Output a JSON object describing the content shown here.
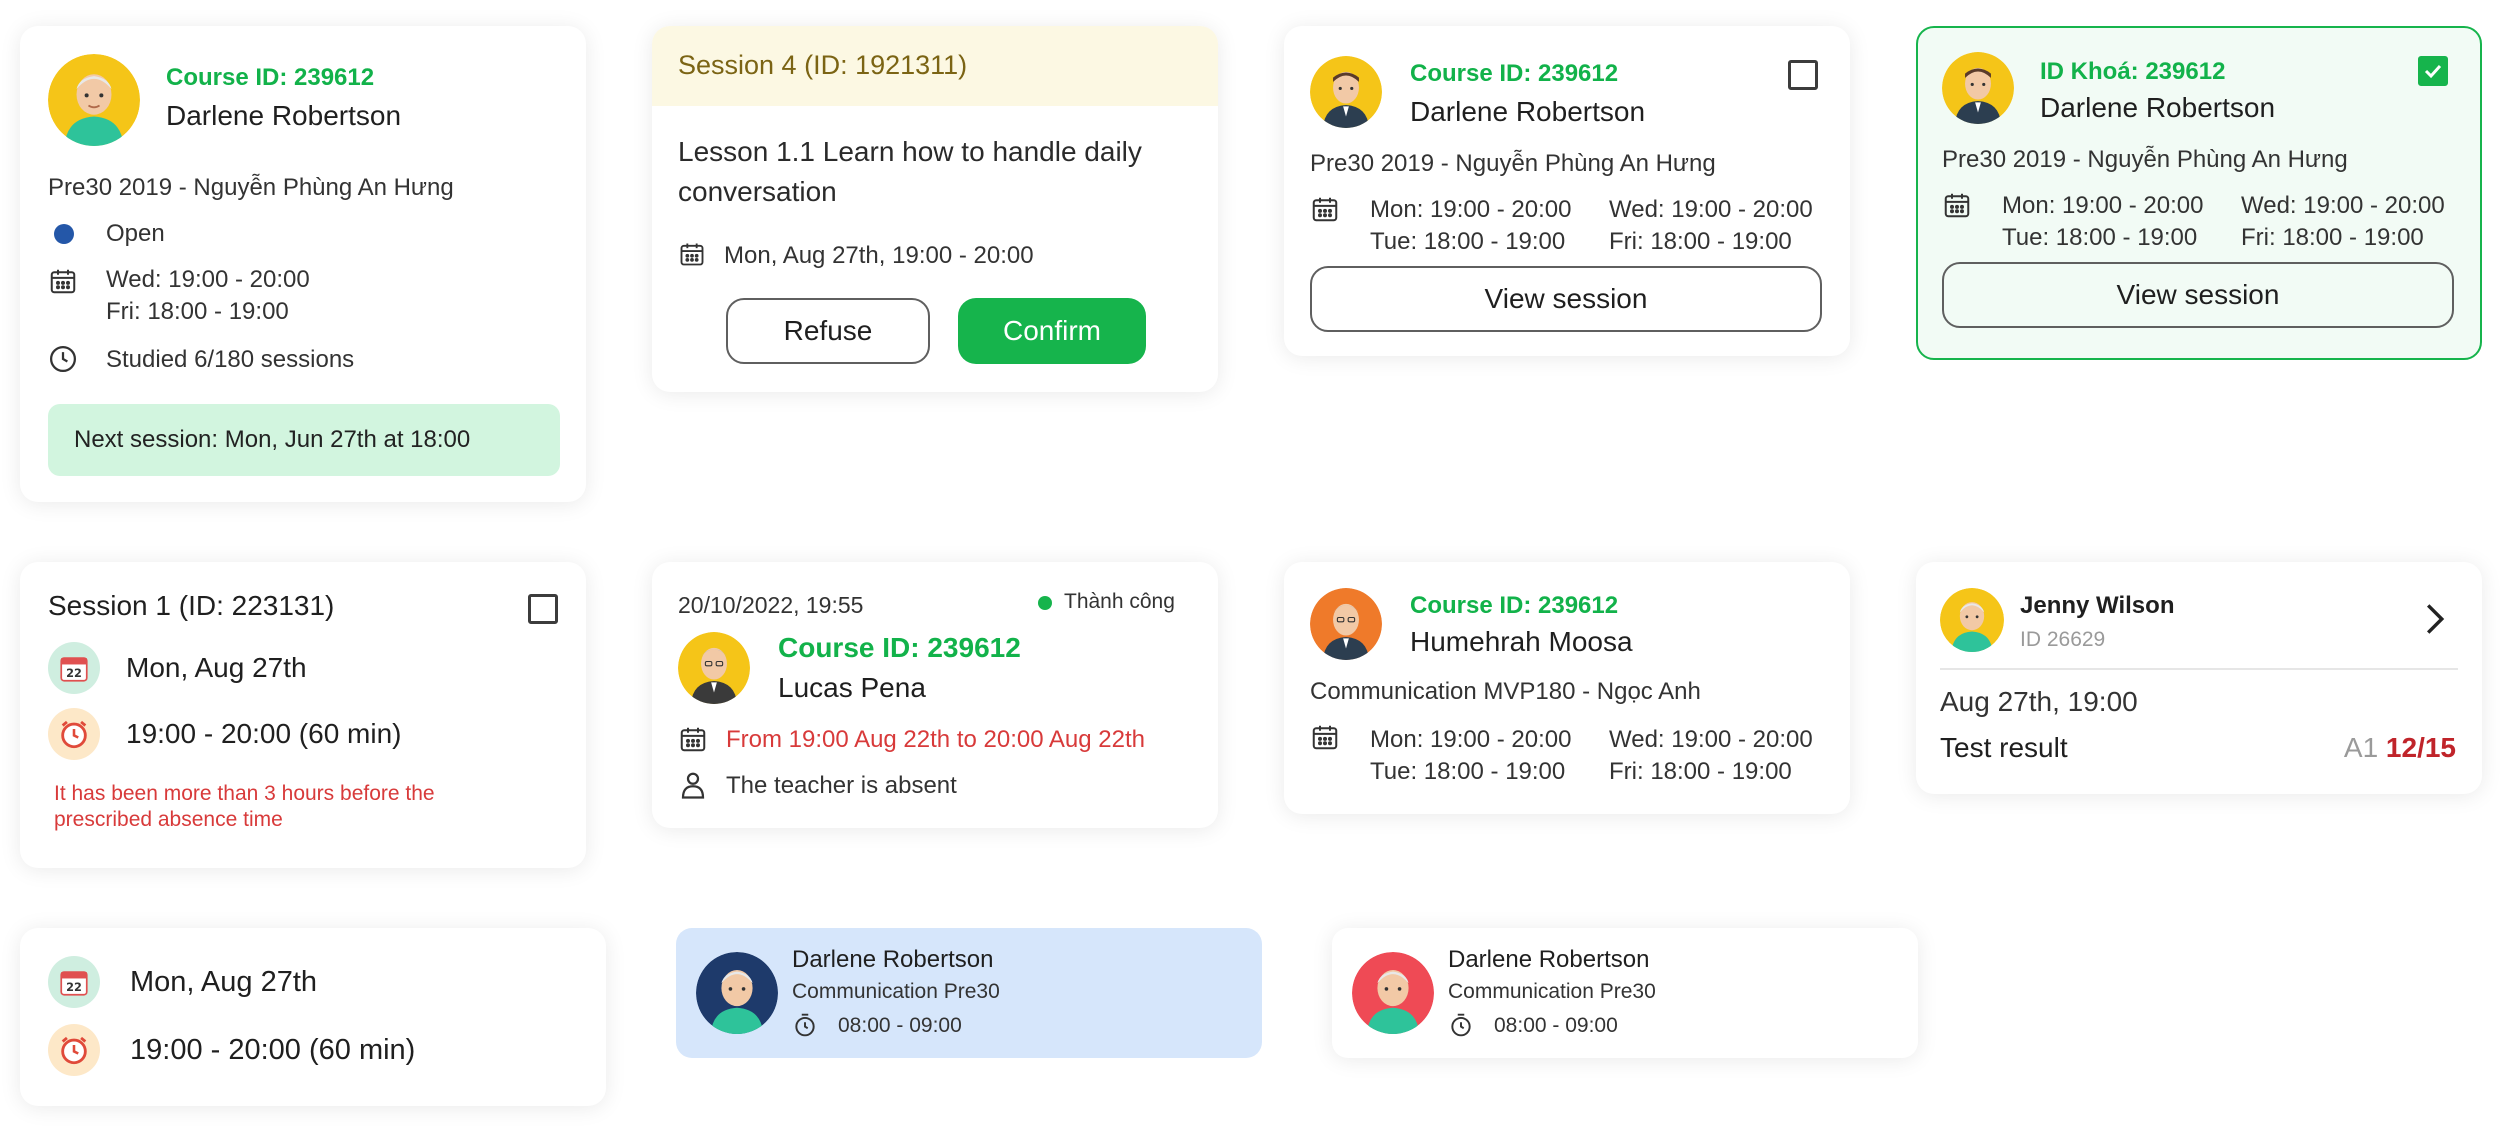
{
  "colors": {
    "accent": "#16b44c",
    "error": "#d83a3a",
    "tag_bg": "#d2f5df",
    "session_header_bg": "#fcf8e3",
    "selected_bg": "#d6e6fb"
  },
  "card1": {
    "course_id": "Course ID: 239612",
    "name": "Darlene Robertson",
    "course": "Pre30 2019 - Nguyễn Phùng An Hưng",
    "status": "Open",
    "schedule_1": "Wed: 19:00 - 20:00",
    "schedule_2": "Fri: 18:00 - 19:00",
    "studied": "Studied 6/180 sessions",
    "next_session": "Next session: Mon, Jun 27th at 18:00"
  },
  "card2": {
    "header": "Session 4 (ID: 1921311)",
    "lesson_line1": "Lesson 1.1 Learn how to handle daily",
    "lesson_line2": "conversation",
    "date": "Mon, Aug 27th, 19:00 - 20:00",
    "refuse_label": "Refuse",
    "confirm_label": "Confirm"
  },
  "card3": {
    "course_id": "Course ID: 239612",
    "name": "Darlene Robertson",
    "course": "Pre30 2019 - Nguyễn Phùng An Hưng",
    "schedule": [
      "Mon: 19:00 - 20:00",
      "Wed: 19:00 - 20:00",
      "Tue: 18:00 - 19:00",
      "Fri: 18:00 - 19:00"
    ],
    "button": "View session",
    "checked": false
  },
  "card4": {
    "course_id": "ID Khoá: 239612",
    "name": "Darlene Robertson",
    "course": "Pre30 2019 - Nguyễn Phùng An Hưng",
    "schedule": [
      "Mon: 19:00 - 20:00",
      "Wed: 19:00 - 20:00",
      "Tue: 18:00 - 19:00",
      "Fri: 18:00 - 19:00"
    ],
    "button": "View session",
    "checked": true
  },
  "card5": {
    "title": "Session 1 (ID: 223131)",
    "date": "Mon, Aug 27th",
    "time": "19:00 - 20:00 (60 min)",
    "warning_line1": "It has been more than 3 hours before the",
    "warning_line2": "prescribed absence time",
    "checked": false
  },
  "card6": {
    "datetime": "20/10/2022, 19:55",
    "status": "Thành công",
    "course_id": "Course ID: 239612",
    "name": "Lucas Pena",
    "range": "From 19:00 Aug 22th to 20:00 Aug 22th",
    "absence": "The teacher is absent"
  },
  "card7": {
    "course_id": "Course ID: 239612",
    "name": "Humehrah Moosa",
    "course": "Communication MVP180 - Ngọc Anh",
    "schedule": [
      "Mon: 19:00 - 20:00",
      "Wed: 19:00 - 20:00",
      "Tue: 18:00 - 19:00",
      "Fri: 18:00 - 19:00"
    ]
  },
  "card8": {
    "name": "Jenny Wilson",
    "id": "ID 26629",
    "date": "Aug 27th, 19:00",
    "result_label": "Test result",
    "level": "A1",
    "score": "12/15"
  },
  "card9": {
    "date": "Mon, Aug 27th",
    "time": "19:00 - 20:00 (60 min)"
  },
  "card10": {
    "name": "Darlene Robertson",
    "course": "Communication Pre30",
    "time": "08:00 - 09:00"
  },
  "card11": {
    "name": "Darlene Robertson",
    "course": "Communication Pre30",
    "time": "08:00 - 09:00"
  },
  "icons": [
    "calendar-icon",
    "clock-icon",
    "status-dot-icon",
    "person-icon",
    "stopwatch-icon",
    "chevron-right-icon",
    "checkbox-icon",
    "calendar-badge-icon",
    "alarm-clock-badge-icon"
  ]
}
